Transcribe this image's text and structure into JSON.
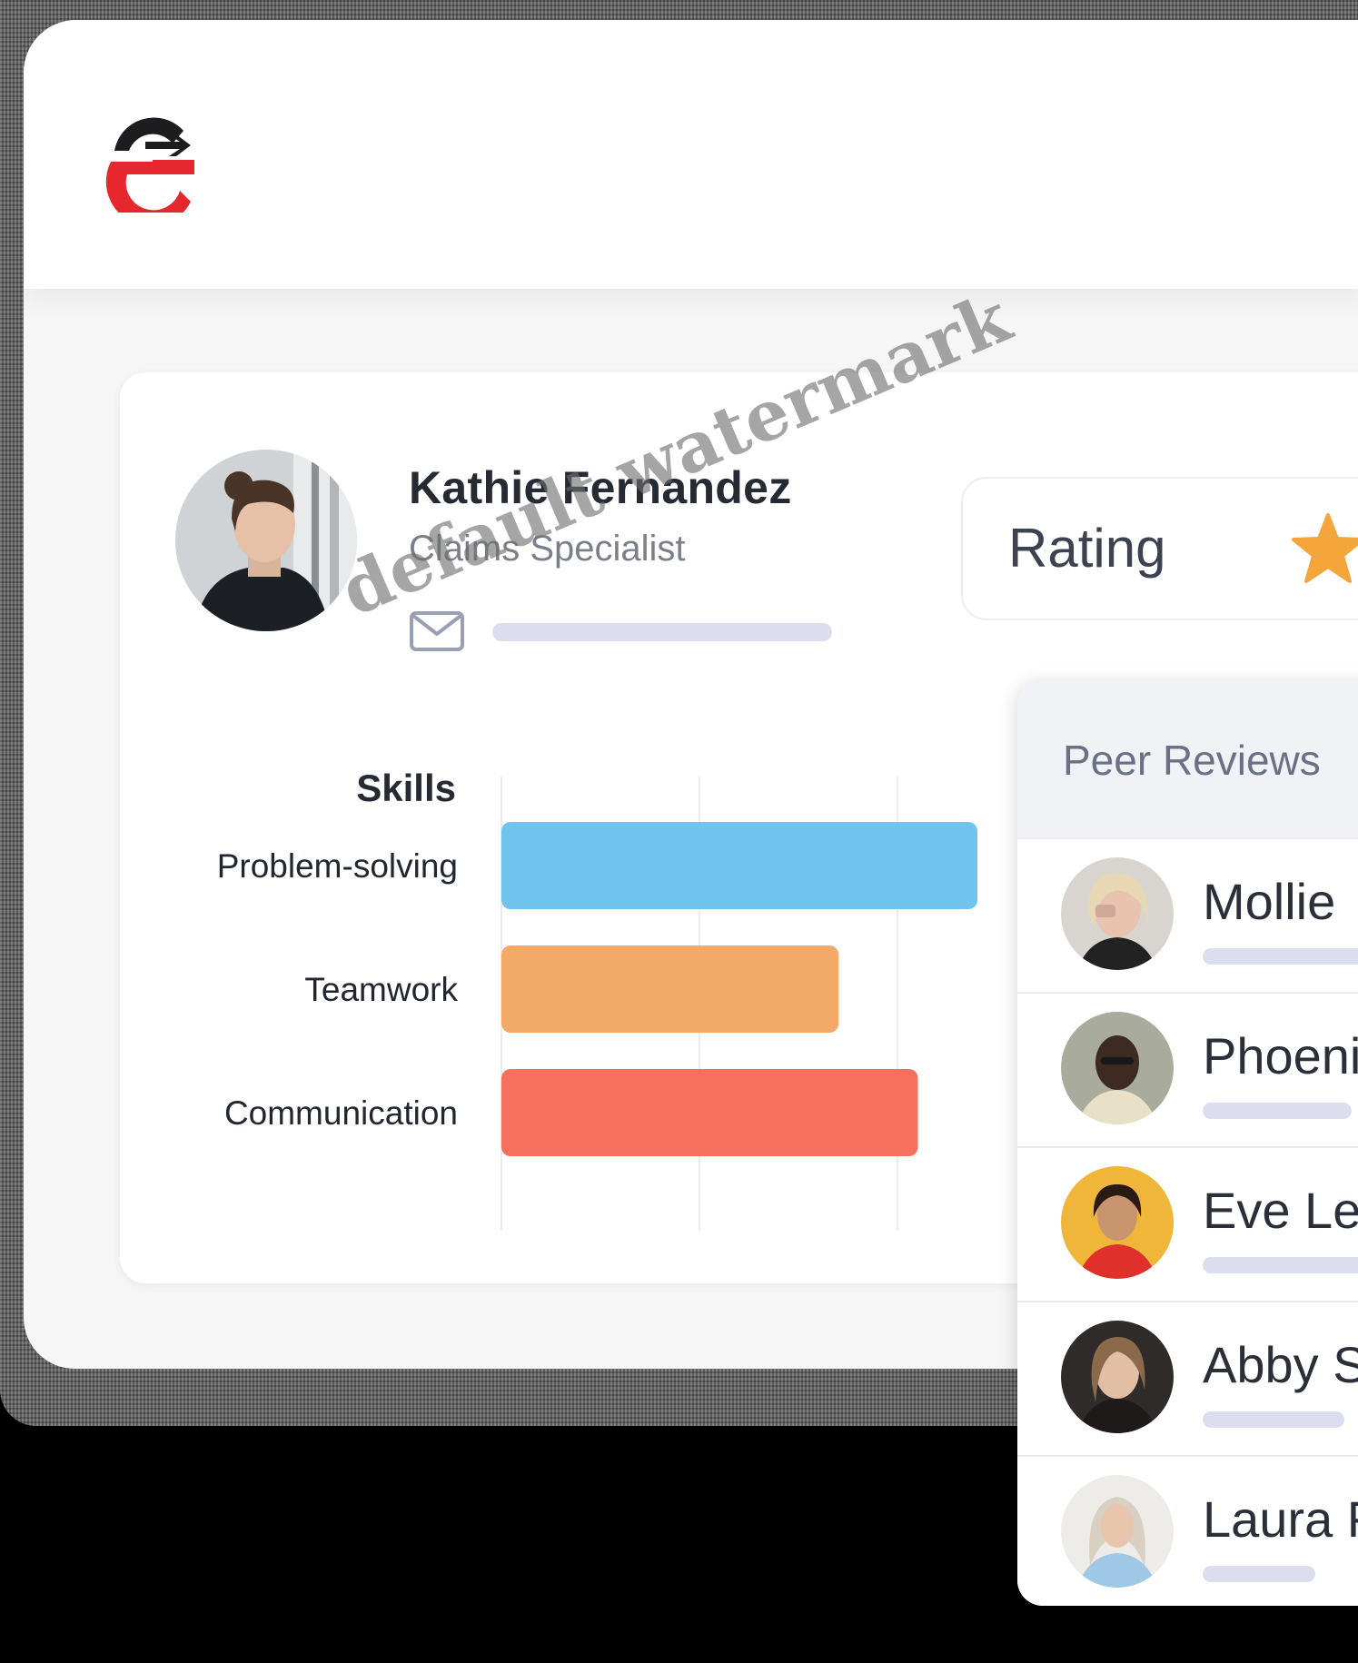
{
  "profile": {
    "name": "Kathie Fernandez",
    "title": "Claims Specialist"
  },
  "rating": {
    "label": "Rating",
    "star_icon": "star-icon",
    "star_color": "#f5a63b"
  },
  "watermark": "default watermark",
  "chart_data": {
    "type": "bar",
    "orientation": "horizontal",
    "title": "Skills",
    "categories": [
      "Problem-solving",
      "Teamwork",
      "Communication"
    ],
    "values": [
      2.4,
      1.7,
      2.1
    ],
    "xlim": [
      0,
      2.4
    ],
    "grid": true,
    "colors": [
      "#71c4ee",
      "#f3a968",
      "#f76f5f"
    ]
  },
  "peer_reviews": {
    "title": "Peer Reviews",
    "items": [
      {
        "name": "Mollie",
        "bar_fraction": 0.55
      },
      {
        "name": "Phoeni",
        "bar_fraction": 0.7
      },
      {
        "name": "Eve Le",
        "bar_fraction": 0.58
      },
      {
        "name": "Abby S",
        "bar_fraction": 0.66
      },
      {
        "name": "Laura F",
        "bar_fraction": 0.56
      }
    ]
  },
  "colors": {
    "brand_red": "#e5282e",
    "brand_dark": "#1a1a1a",
    "placeholder_bar": "#dcdeef"
  }
}
